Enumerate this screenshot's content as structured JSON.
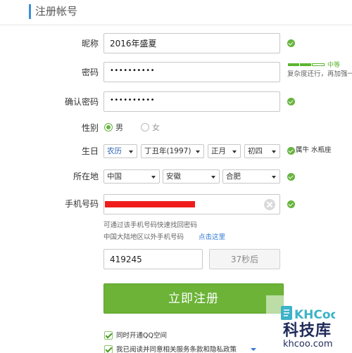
{
  "header": {
    "title": "注册帐号"
  },
  "form": {
    "nickname": {
      "label": "昵称",
      "value": "2016年盛夏"
    },
    "password": {
      "label": "密码",
      "masked": "••••••••••"
    },
    "password_strength": {
      "level_text": "中等",
      "level_fraction": 0.67,
      "hint": "复杂度还行，再加强一"
    },
    "confirm_password": {
      "label": "确认密码",
      "masked": "••••••••••"
    },
    "gender": {
      "label": "性别",
      "options": [
        "男",
        "女"
      ],
      "selected": "男"
    },
    "birthday": {
      "label": "生日",
      "calendar": "农历",
      "year": "丁丑年(1997)",
      "month": "正月",
      "day": "初四",
      "zodiac": "属牛  水瓶座"
    },
    "location": {
      "label": "所在地",
      "country": "中国",
      "province": "安徽",
      "city": "合肥"
    },
    "phone": {
      "label": "手机号码",
      "note1": "可通过该手机号码快速找回密码",
      "note2": "中国大陆地区以外手机号码",
      "link": "点击这里"
    },
    "verify_code": {
      "value": "419245",
      "countdown": "37秒后"
    },
    "submit_label": "立即注册",
    "agreements": [
      {
        "label": "同时开通QQ空间",
        "checked": true
      },
      {
        "label": "我已阅读并同意相关服务条款和隐私政策",
        "checked": true
      }
    ]
  },
  "watermark": {
    "brand": "KHCoo",
    "name": "科技库",
    "url": "khcoo.com"
  },
  "colors": {
    "accent_green": "#6cb338",
    "check_green": "#68b440",
    "link_blue": "#2d78d1",
    "header_bar": "#3a8fd9",
    "redaction_red": "#f01c1c"
  }
}
